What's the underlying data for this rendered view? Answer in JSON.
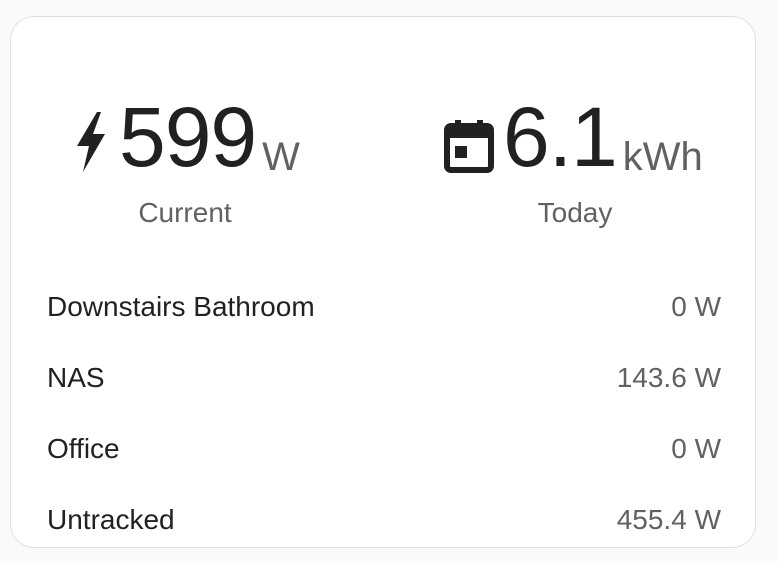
{
  "summary": {
    "current": {
      "icon": "lightning-bolt-icon",
      "value": "599",
      "unit": "W",
      "label": "Current"
    },
    "today": {
      "icon": "calendar-today-icon",
      "value": "6.1",
      "unit": "kWh",
      "label": "Today"
    }
  },
  "devices": [
    {
      "name": "Downstairs Bathroom",
      "value": "0 W"
    },
    {
      "name": "NAS",
      "value": "143.6 W"
    },
    {
      "name": "Office",
      "value": "0 W"
    },
    {
      "name": "Untracked",
      "value": "455.4 W"
    }
  ],
  "colors": {
    "text_primary": "#212121",
    "text_secondary": "#616161",
    "card_border": "#e0e0e0"
  }
}
